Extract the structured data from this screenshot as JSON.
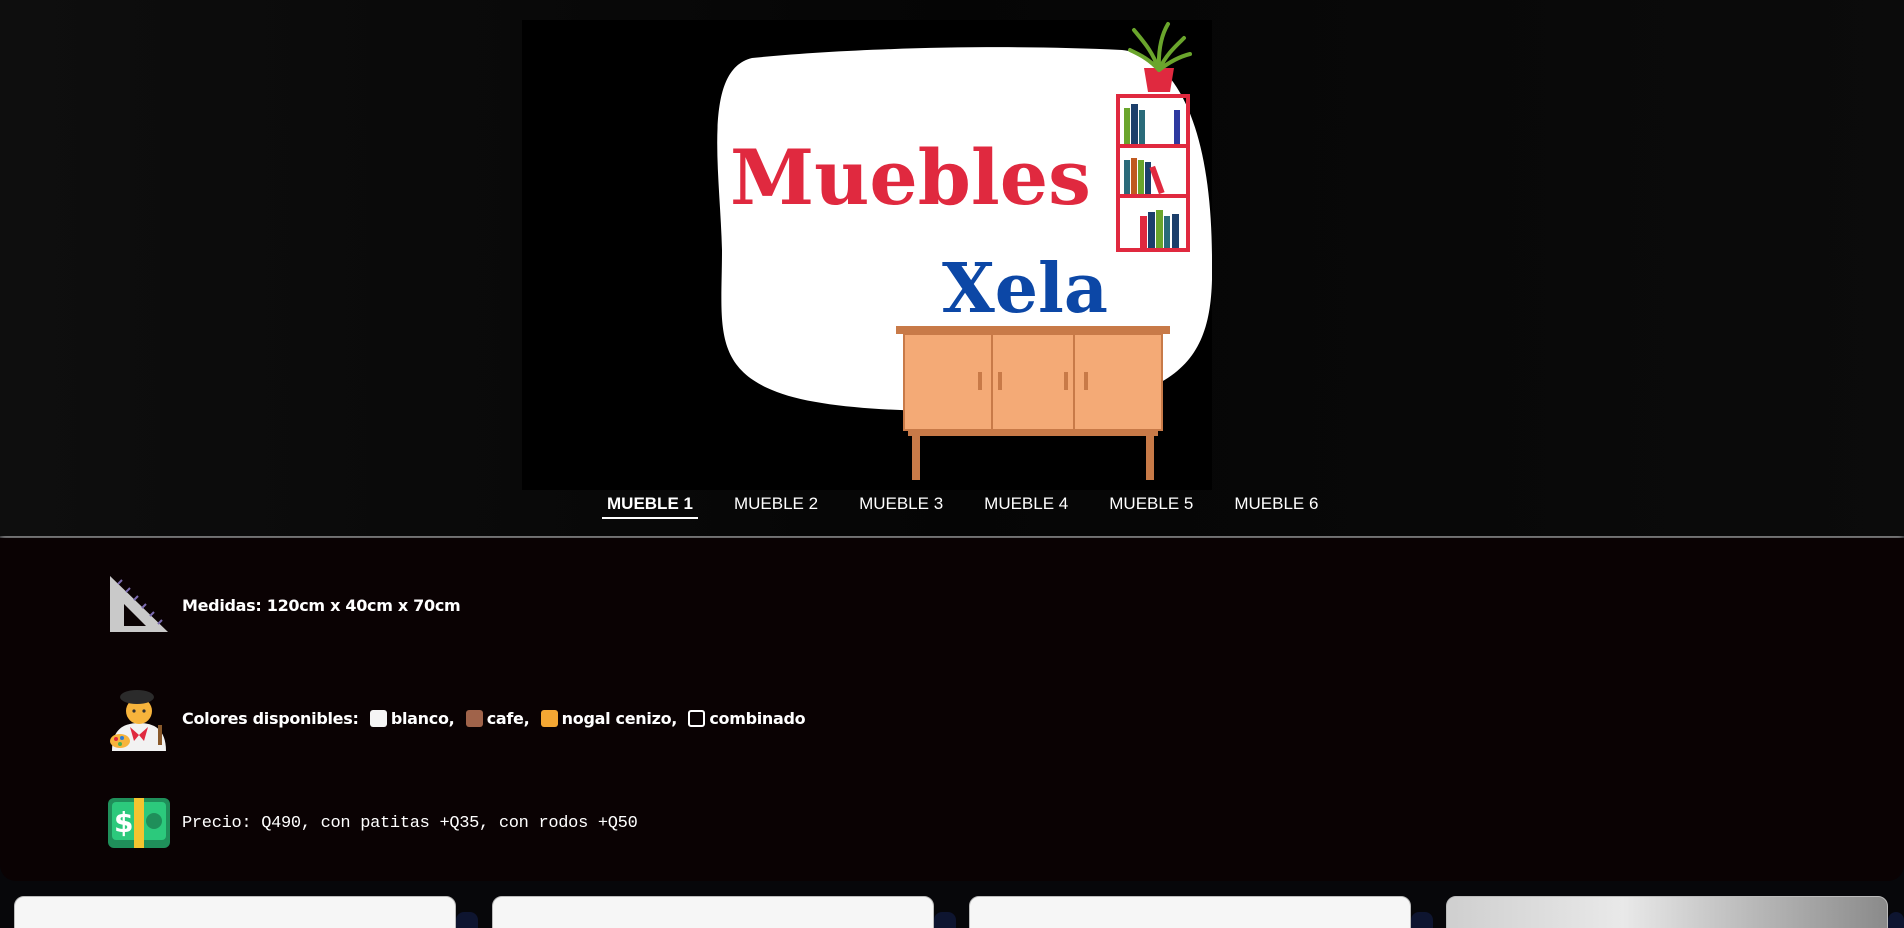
{
  "logo": {
    "line1": "Muebles",
    "line2": "Xela",
    "line1_color": "#e0293f",
    "line2_color": "#0c47a6"
  },
  "nav": {
    "items": [
      {
        "label": "MUEBLE 1",
        "active": true
      },
      {
        "label": "MUEBLE 2",
        "active": false
      },
      {
        "label": "MUEBLE 3",
        "active": false
      },
      {
        "label": "MUEBLE 4",
        "active": false
      },
      {
        "label": "MUEBLE 5",
        "active": false
      },
      {
        "label": "MUEBLE 6",
        "active": false
      }
    ]
  },
  "info": {
    "medidas": {
      "icon": "triangle-ruler-icon",
      "text": "Medidas: 120cm x 40cm x 70cm"
    },
    "colores": {
      "icon": "artist-icon",
      "label": "Colores disponibles:",
      "options": [
        {
          "name": "blanco,",
          "color": "#f5f5f5"
        },
        {
          "name": "cafe,",
          "color": "#a0634a"
        },
        {
          "name": "nogal cenizo,",
          "color": "#f4a733"
        },
        {
          "name": "combinado",
          "color": "outline"
        }
      ]
    },
    "precio": {
      "icon": "dollar-bill-icon",
      "text": "Precio: Q490, con patitas +Q35, con rodos +Q50"
    }
  },
  "colors": {
    "header_bg": "#0a0a0a",
    "panel_bg": "#0a0203",
    "accent_navy": "#0e1530"
  }
}
